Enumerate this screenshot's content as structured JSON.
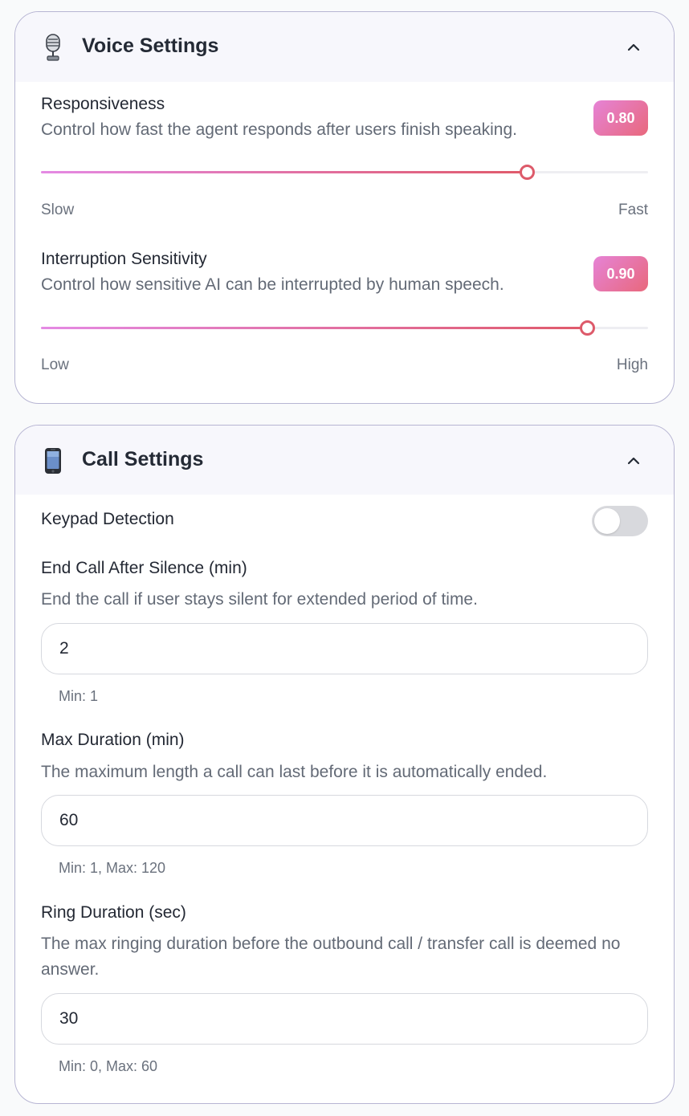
{
  "voice_settings": {
    "title": "Voice Settings",
    "icon": "microphone-icon",
    "responsiveness": {
      "label": "Responsiveness",
      "description": "Control how fast the agent responds after users finish speaking.",
      "value_display": "0.80",
      "value": 0.8,
      "min_label": "Slow",
      "max_label": "Fast"
    },
    "interruption": {
      "label": "Interruption Sensitivity",
      "description": "Control how sensitive AI can be interrupted by human speech.",
      "value_display": "0.90",
      "value": 0.9,
      "min_label": "Low",
      "max_label": "High"
    }
  },
  "call_settings": {
    "title": "Call Settings",
    "icon": "mobile-phone-icon",
    "keypad_detection": {
      "label": "Keypad Detection",
      "enabled": false
    },
    "end_call_after_silence": {
      "label": "End Call After Silence (min)",
      "description": "End the call if user stays silent for extended period of time.",
      "value": "2",
      "hint": "Min: 1"
    },
    "max_duration": {
      "label": "Max Duration (min)",
      "description": "The maximum length a call can last before it is automatically ended.",
      "value": "60",
      "hint": "Min: 1, Max: 120"
    },
    "ring_duration": {
      "label": "Ring Duration (sec)",
      "description": "The max ringing duration before the outbound call / transfer call is deemed no answer.",
      "value": "30",
      "hint": "Min: 0, Max: 60"
    }
  },
  "colors": {
    "accent_start": "#e683d6",
    "accent_end": "#e05a6a",
    "card_border": "#b7b5d3",
    "header_bg": "#f7f7fc"
  }
}
